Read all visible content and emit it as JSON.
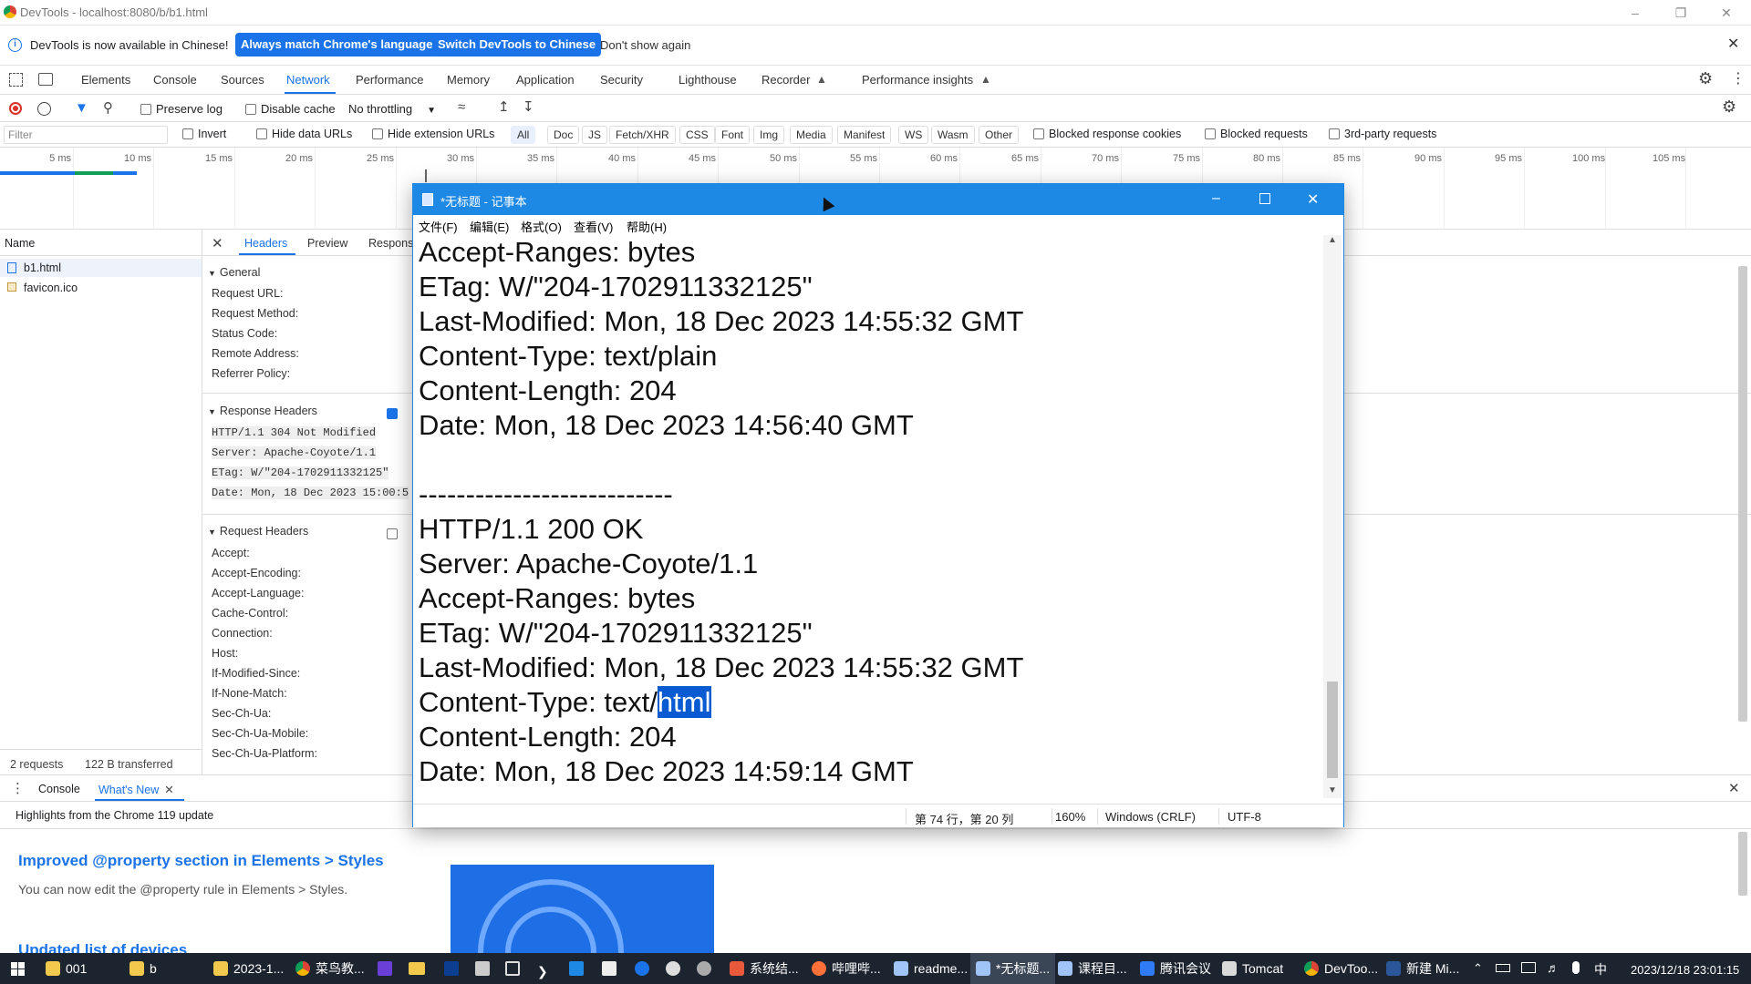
{
  "window": {
    "title": "DevTools - localhost:8080/b/b1.html"
  },
  "infobar": {
    "message": "DevTools is now available in Chinese!",
    "btn_match": "Always match Chrome's language",
    "btn_switch": "Switch DevTools to Chinese",
    "dont_show": "Don't show again"
  },
  "tabs": [
    "Elements",
    "Console",
    "Sources",
    "Network",
    "Performance",
    "Memory",
    "Application",
    "Security",
    "Lighthouse",
    "Recorder",
    "Performance insights"
  ],
  "network": {
    "preserve_log": "Preserve log",
    "disable_cache": "Disable cache",
    "throttling": "No throttling"
  },
  "filters": {
    "placeholder": "Filter",
    "invert": "Invert",
    "hide_data_urls": "Hide data URLs",
    "hide_ext_urls": "Hide extension URLs",
    "types": [
      "All",
      "Doc",
      "JS",
      "Fetch/XHR",
      "CSS",
      "Font",
      "Img",
      "Media",
      "Manifest",
      "WS",
      "Wasm",
      "Other"
    ],
    "blocked_cookies": "Blocked response cookies",
    "blocked_requests": "Blocked requests",
    "third_party": "3rd-party requests"
  },
  "timeline": {
    "ticks": [
      "5 ms",
      "10 ms",
      "15 ms",
      "20 ms",
      "25 ms",
      "30 ms",
      "35 ms",
      "40 ms",
      "45 ms",
      "50 ms",
      "55 ms",
      "60 ms",
      "65 ms",
      "70 ms",
      "75 ms",
      "80 ms",
      "85 ms",
      "90 ms",
      "95 ms",
      "100 ms",
      "105 ms"
    ]
  },
  "requests": {
    "header": "Name",
    "items": [
      "b1.html",
      "favicon.ico"
    ],
    "summary_count": "2 requests",
    "summary_transferred": "122 B transferred"
  },
  "detail": {
    "tabs": [
      "Headers",
      "Preview",
      "Respons"
    ],
    "general_title": "General",
    "general_keys": [
      "Request URL:",
      "Request Method:",
      "Status Code:",
      "Remote Address:",
      "Referrer Policy:"
    ],
    "response_title": "Response Headers",
    "response_raw": [
      "HTTP/1.1 304 Not Modified",
      "Server: Apache-Coyote/1.1",
      "ETag: W/\"204-1702911332125\"",
      "Date: Mon, 18 Dec 2023 15:00:5"
    ],
    "request_title": "Request Headers",
    "request_keys": [
      "Accept:",
      "Accept-Encoding:",
      "Accept-Language:",
      "Cache-Control:",
      "Connection:",
      "Host:",
      "If-Modified-Since:",
      "If-None-Match:",
      "Sec-Ch-Ua:",
      "Sec-Ch-Ua-Mobile:",
      "Sec-Ch-Ua-Platform:"
    ]
  },
  "drawer": {
    "tabs": [
      "Console",
      "What's New"
    ],
    "highlight": "Highlights from the Chrome 119 update",
    "article_title": "Improved @property section in Elements > Styles",
    "article_body": "You can now edit the @property rule in Elements > Styles.",
    "article2_title": "Updated list of devices"
  },
  "notepad": {
    "title": "*无标题 - 记事本",
    "menu": [
      "文件(F)",
      "编辑(E)",
      "格式(O)",
      "查看(V)",
      "帮助(H)"
    ],
    "lines": [
      "Accept-Ranges: bytes",
      "ETag: W/\"204-1702911332125\"",
      "Last-Modified: Mon, 18 Dec 2023 14:55:32 GMT",
      "Content-Type: text/plain",
      "Content-Length: 204",
      "Date: Mon, 18 Dec 2023 14:56:40 GMT",
      "",
      "---------------------------",
      "HTTP/1.1 200 OK",
      "Server: Apache-Coyote/1.1",
      "Accept-Ranges: bytes",
      "ETag: W/\"204-1702911332125\"",
      "Last-Modified: Mon, 18 Dec 2023 14:55:32 GMT",
      "Content-Type: text/",
      "Content-Length: 204",
      "Date: Mon, 18 Dec 2023 14:59:14 GMT"
    ],
    "selected": "html",
    "status": {
      "position": "第 74 行，第 20 列",
      "zoom": "160%",
      "eol": "Windows (CRLF)",
      "encoding": "UTF-8"
    }
  },
  "taskbar": {
    "items": [
      "001",
      "b",
      "2023-1...",
      "菜鸟教...",
      "系统结...",
      "哔哩哔...",
      "readme...",
      "*无标题...",
      "课程目...",
      "腾讯会议",
      "Tomcat",
      "DevToo...",
      "新建 Mi..."
    ],
    "clock": "2023/12/18 23:01:15"
  }
}
